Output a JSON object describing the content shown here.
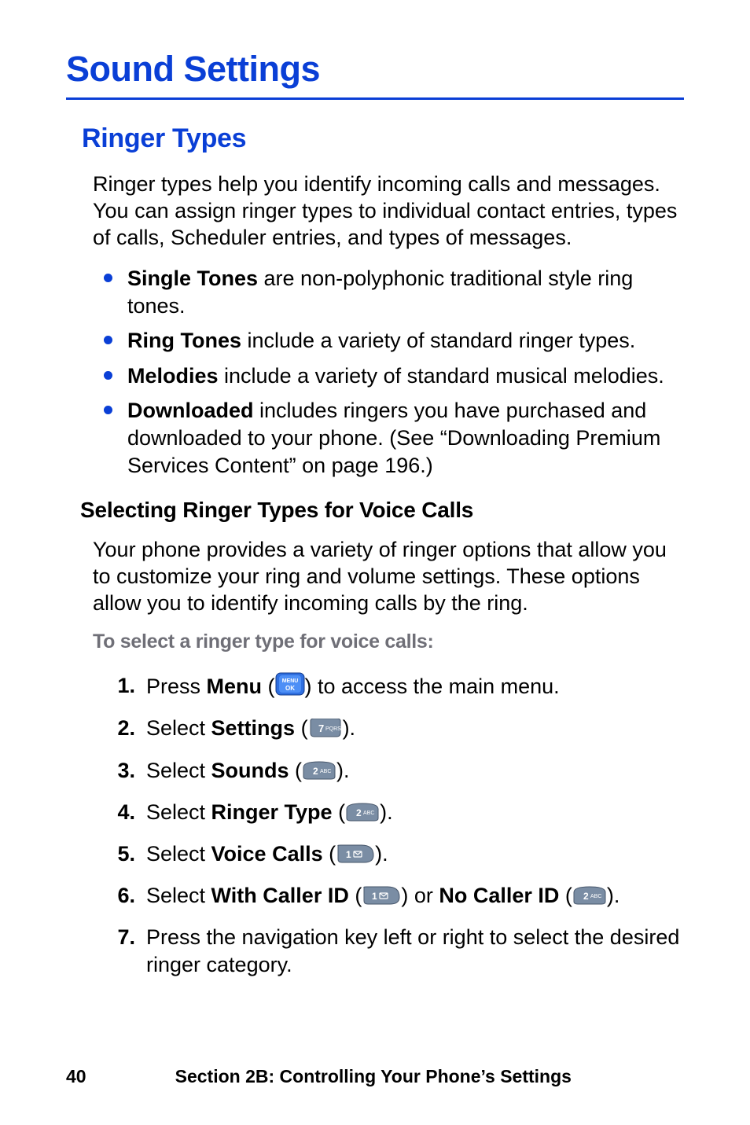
{
  "title": "Sound Settings",
  "section_heading": "Ringer Types",
  "intro": "Ringer types help you identify incoming calls and messages. You can assign ringer types to individual contact entries, types of calls, Scheduler entries, and types of messages.",
  "bullets": [
    {
      "bold": "Single Tones",
      "rest": " are non-polyphonic traditional style ring tones."
    },
    {
      "bold": "Ring Tones",
      "rest": " include a variety of standard ringer types."
    },
    {
      "bold": "Melodies",
      "rest": " include a variety of standard musical melodies."
    },
    {
      "bold": "Downloaded",
      "rest": " includes ringers you have purchased and downloaded to your phone. (See “Downloading Premium Services Content” on page 196.)"
    }
  ],
  "subheading": "Selecting Ringer Types for Voice Calls",
  "sub_para": "Your phone provides a variety of ringer options that allow you to customize your ring and volume settings. These options allow you to identify incoming calls by the ring.",
  "lead_in": "To select a ringer type for voice calls:",
  "steps": {
    "s1_a": "Press ",
    "s1_bold": "Menu",
    "s1_b": " (",
    "s1_c": ") to access the main menu.",
    "s2_a": "Select ",
    "s2_bold": "Settings",
    "s2_b": " (",
    "s2_c": ").",
    "s3_a": "Select ",
    "s3_bold": "Sounds",
    "s3_b": " (",
    "s3_c": ").",
    "s4_a": "Select ",
    "s4_bold": "Ringer Type",
    "s4_b": " (",
    "s4_c": ").",
    "s5_a": "Select ",
    "s5_bold": "Voice Calls",
    "s5_b": " (",
    "s5_c": ").",
    "s6_a": "Select ",
    "s6_bold1": "With Caller ID",
    "s6_b": " (",
    "s6_c": ") or ",
    "s6_bold2": "No Caller ID",
    "s6_d": " (",
    "s6_e": ").",
    "s7": "Press the navigation key left or right to select the desired ringer category."
  },
  "footer": {
    "page": "40",
    "section": "Section 2B: Controlling Your Phone’s Settings"
  }
}
